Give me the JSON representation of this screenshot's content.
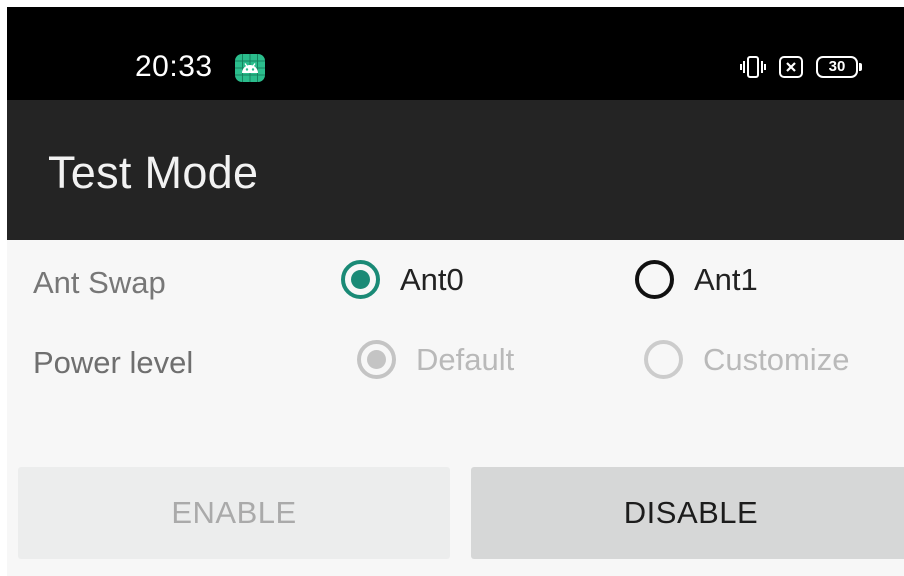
{
  "status_bar": {
    "time": "20:33",
    "app_icon": "android-debug-icon",
    "icons": [
      "vibrate-icon",
      "no-sim-icon",
      "battery-icon"
    ],
    "battery_level": "30"
  },
  "app_bar": {
    "title": "Test Mode"
  },
  "ant_swap": {
    "label": "Ant Swap",
    "options": [
      {
        "label": "Ant0",
        "selected": true
      },
      {
        "label": "Ant1",
        "selected": false
      }
    ]
  },
  "power_level": {
    "label": "Power level",
    "enabled": false,
    "options": [
      {
        "label": "Default",
        "selected": true
      },
      {
        "label": "Customize",
        "selected": false
      }
    ]
  },
  "buttons": {
    "enable_label": "ENABLE",
    "enable_enabled": false,
    "disable_label": "DISABLE",
    "disable_enabled": true
  },
  "colors": {
    "accent": "#1a8a76",
    "status_bar_bg": "#000000",
    "app_bar_bg": "#242424",
    "content_bg": "#f7f7f7"
  }
}
